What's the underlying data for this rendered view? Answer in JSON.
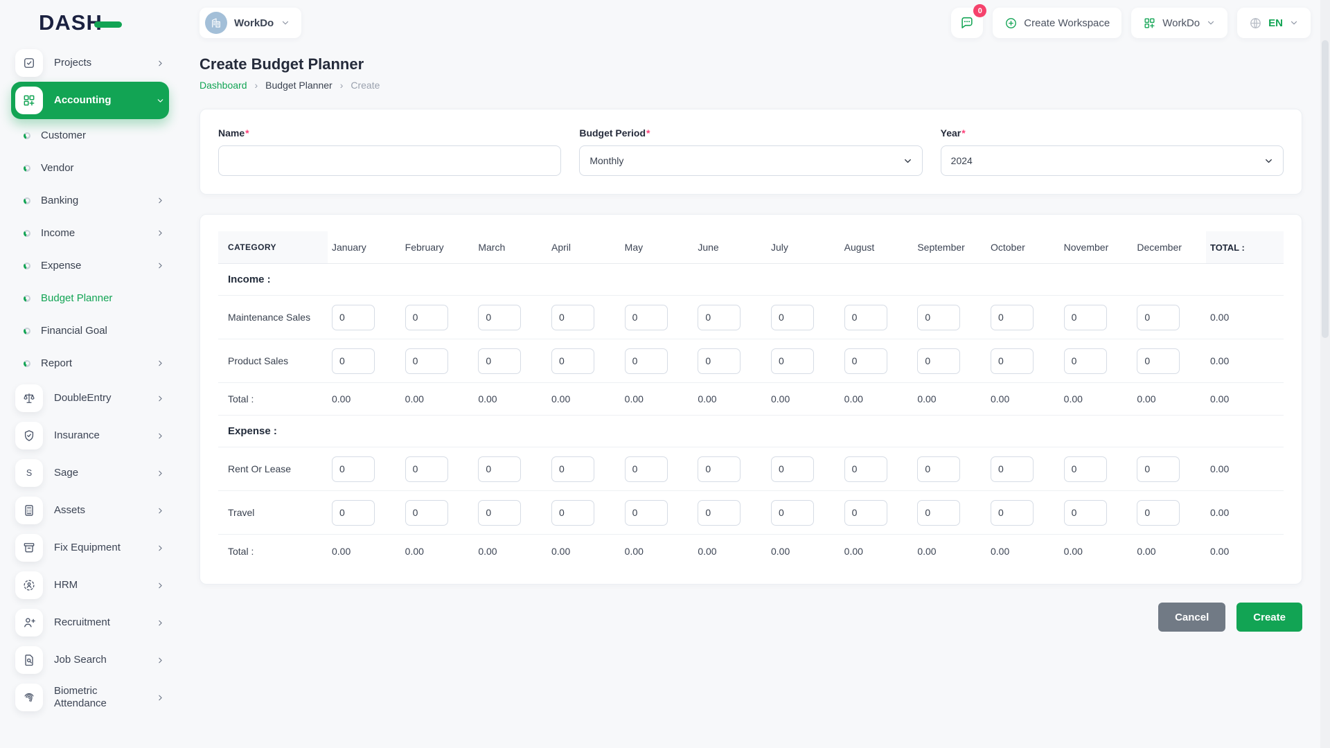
{
  "brand": {
    "logo_text": "DASH"
  },
  "header": {
    "workspace_label": "WorkDo",
    "workspace_icon": "building-icon",
    "messages_icon": "chat-icon",
    "messages_badge": "0",
    "create_workspace_label": "Create Workspace",
    "create_workspace_icon": "plus-circle-icon",
    "app_switcher_label": "WorkDo",
    "app_switcher_icon": "grid-plus-icon",
    "language_label": "EN",
    "language_icon": "globe-icon"
  },
  "sidebar": {
    "items": [
      {
        "label": "Projects",
        "type": "top",
        "icon": "tasks-icon",
        "chevron": "right"
      },
      {
        "label": "Accounting",
        "type": "top-active",
        "icon": "grid-plus-icon",
        "chevron": "down"
      },
      {
        "label": "Customer",
        "type": "sub"
      },
      {
        "label": "Vendor",
        "type": "sub"
      },
      {
        "label": "Banking",
        "type": "sub",
        "chevron": "right"
      },
      {
        "label": "Income",
        "type": "sub",
        "chevron": "right"
      },
      {
        "label": "Expense",
        "type": "sub",
        "chevron": "right"
      },
      {
        "label": "Budget Planner",
        "type": "sub-active"
      },
      {
        "label": "Financial Goal",
        "type": "sub"
      },
      {
        "label": "Report",
        "type": "sub",
        "chevron": "right"
      },
      {
        "label": "DoubleEntry",
        "type": "top",
        "icon": "scales-icon",
        "chevron": "right"
      },
      {
        "label": "Insurance",
        "type": "top",
        "icon": "shield-check-icon",
        "chevron": "right"
      },
      {
        "label": "Sage",
        "type": "top",
        "icon": "sage-icon",
        "chevron": "right"
      },
      {
        "label": "Assets",
        "type": "top",
        "icon": "calculator-icon",
        "chevron": "right"
      },
      {
        "label": "Fix Equipment",
        "type": "top",
        "icon": "equipment-icon",
        "chevron": "right"
      },
      {
        "label": "HRM",
        "type": "top",
        "icon": "hrm-icon",
        "chevron": "right"
      },
      {
        "label": "Recruitment",
        "type": "top",
        "icon": "person-plus-icon",
        "chevron": "right"
      },
      {
        "label": "Job Search",
        "type": "top",
        "icon": "doc-search-icon",
        "chevron": "right"
      },
      {
        "label": "Biometric Attendance",
        "type": "top",
        "icon": "fingerprint-icon",
        "chevron": "right"
      }
    ]
  },
  "page": {
    "title": "Create Budget Planner",
    "breadcrumb": [
      "Dashboard",
      "Budget Planner",
      "Create"
    ]
  },
  "form": {
    "required_mark": "*",
    "fields": [
      {
        "label": "Name",
        "type": "input",
        "value": ""
      },
      {
        "label": "Budget Period",
        "type": "select",
        "value": "Monthly"
      },
      {
        "label": "Year",
        "type": "select",
        "value": "2024"
      }
    ]
  },
  "table": {
    "category_header": "CATEGORY",
    "total_header": "TOTAL :",
    "months": [
      "January",
      "February",
      "March",
      "April",
      "May",
      "June",
      "July",
      "August",
      "September",
      "October",
      "November",
      "December"
    ],
    "sections": [
      {
        "label": "Income :",
        "rows": [
          {
            "label": "Maintenance Sales",
            "values": [
              "0",
              "0",
              "0",
              "0",
              "0",
              "0",
              "0",
              "0",
              "0",
              "0",
              "0",
              "0"
            ],
            "total": "0.00"
          },
          {
            "label": "Product Sales",
            "values": [
              "0",
              "0",
              "0",
              "0",
              "0",
              "0",
              "0",
              "0",
              "0",
              "0",
              "0",
              "0"
            ],
            "total": "0.00"
          }
        ],
        "total_label": "Total :",
        "month_totals": [
          "0.00",
          "0.00",
          "0.00",
          "0.00",
          "0.00",
          "0.00",
          "0.00",
          "0.00",
          "0.00",
          "0.00",
          "0.00",
          "0.00"
        ],
        "grand_total": "0.00"
      },
      {
        "label": "Expense :",
        "rows": [
          {
            "label": "Rent Or Lease",
            "values": [
              "0",
              "0",
              "0",
              "0",
              "0",
              "0",
              "0",
              "0",
              "0",
              "0",
              "0",
              "0"
            ],
            "total": "0.00"
          },
          {
            "label": "Travel",
            "values": [
              "0",
              "0",
              "0",
              "0",
              "0",
              "0",
              "0",
              "0",
              "0",
              "0",
              "0",
              "0"
            ],
            "total": "0.00"
          }
        ],
        "total_label": "Total :",
        "month_totals": [
          "0.00",
          "0.00",
          "0.00",
          "0.00",
          "0.00",
          "0.00",
          "0.00",
          "0.00",
          "0.00",
          "0.00",
          "0.00",
          "0.00"
        ],
        "grand_total": "0.00"
      }
    ]
  },
  "actions": {
    "cancel_label": "Cancel",
    "create_label": "Create"
  },
  "colors": {
    "accent_green": "#12a454",
    "badge_red": "#f5426c",
    "logo_navy": "#1b2140",
    "cancel_gray": "#717a85"
  }
}
